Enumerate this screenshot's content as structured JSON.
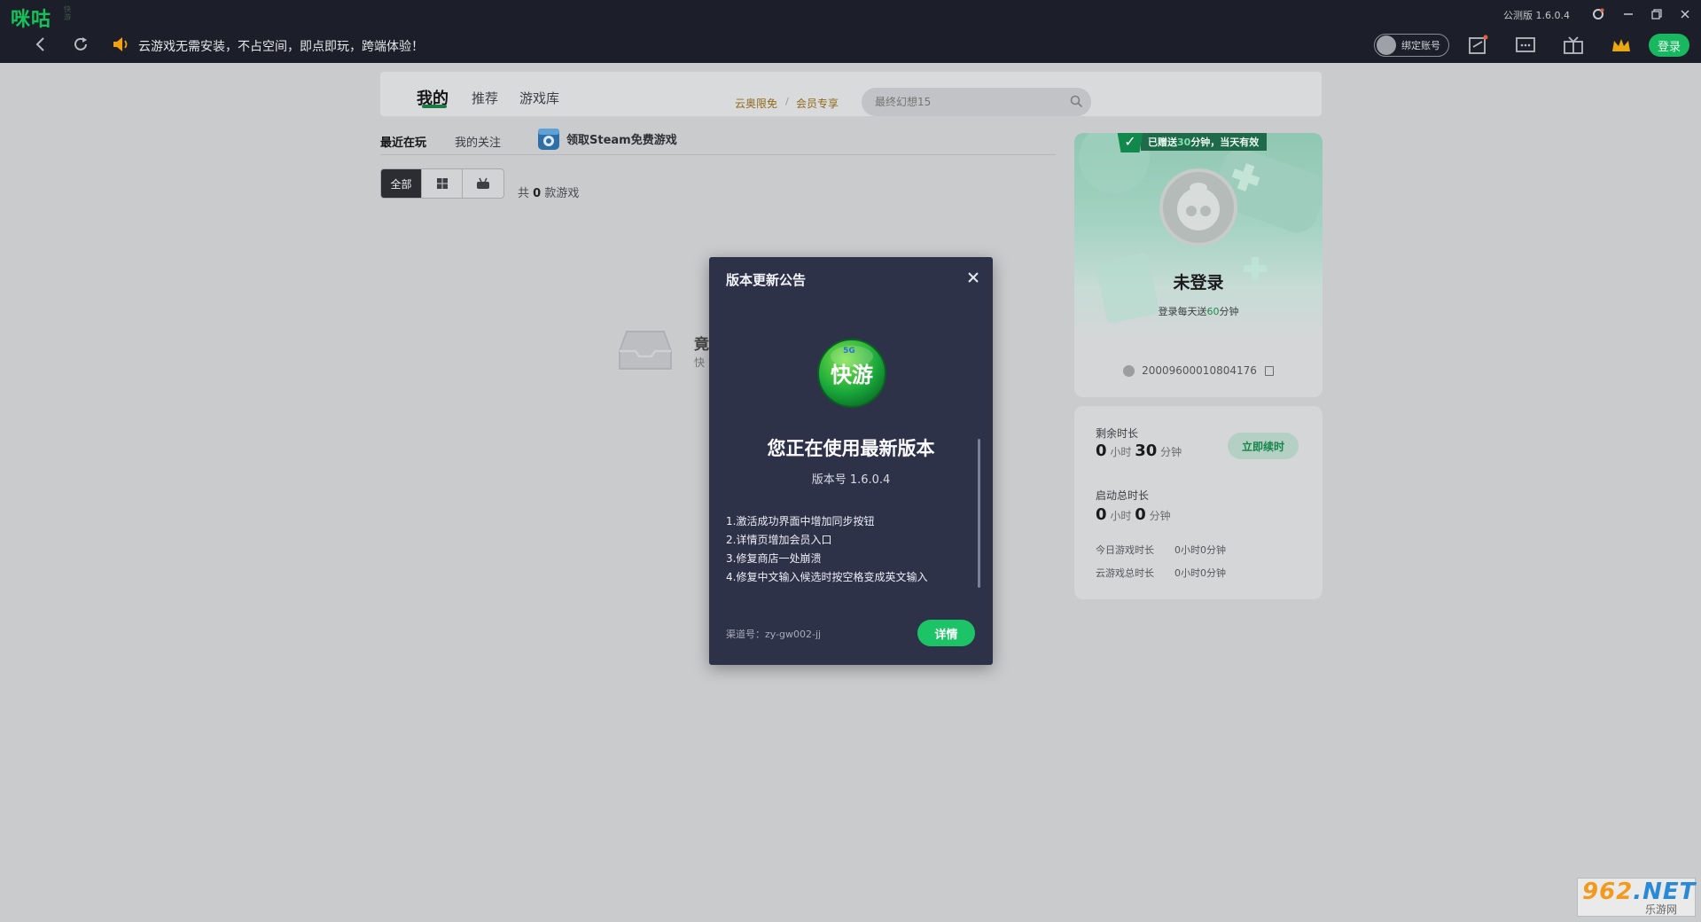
{
  "app": {
    "logo": "咪咕",
    "logo_sub": "快游",
    "version_label": "公测版 1.6.0.4"
  },
  "toolbar": {
    "notice": "云游戏无需安装，不占空间，即点即玩，跨端体验！",
    "steam_bind": "绑定账号",
    "login": "登录"
  },
  "nav": {
    "tabs": [
      "我的",
      "推荐",
      "游戏库"
    ],
    "promos": [
      "云奥限免",
      "会员专享"
    ],
    "promo_sep": "/",
    "search_placeholder": "最终幻想15"
  },
  "library": {
    "subtabs": [
      "最近在玩",
      "我的关注"
    ],
    "steam_free": "领取Steam免费游戏",
    "filters": [
      "全部",
      "windows",
      "console"
    ],
    "count_prefix": "共",
    "count": "0",
    "count_suffix": "款游戏",
    "empty_title": "竟",
    "empty_sub": "快"
  },
  "profile": {
    "gift_prefix": "已赠送",
    "gift_minutes": "30",
    "gift_suffix": "分钟，当天有效",
    "name": "未登录",
    "daily_prefix": "登录每天送",
    "daily_minutes": "60",
    "daily_suffix": "分钟",
    "uid": "2000960001080417​6"
  },
  "time": {
    "remaining_label": "剩余时长",
    "remaining_h": "0",
    "remaining_m": "30",
    "hour_unit": "小时",
    "min_unit": "分钟",
    "renew": "立即续时",
    "total_label": "启动总时长",
    "total_h": "0",
    "total_m": "0",
    "today_label": "今日游戏时长",
    "today_value": "0小时0分钟",
    "cloud_label": "云游戏总时长",
    "cloud_value": "0小时0分钟"
  },
  "modal": {
    "title": "版本更新公告",
    "logo_text": "快游",
    "logo_badge": "5G",
    "heading": "您正在使用最新版本",
    "version": "版本号 1.6.0.4",
    "notes": [
      "1.激活成功界面中增加同步按钮",
      "2.详情页增加会员入口",
      "3.修复商店一处崩溃",
      "4.修复中文输入候选时按空格变成英文输入"
    ],
    "channel": "渠道号：zy-gw002-jj",
    "detail": "详情"
  },
  "watermark": {
    "num": "962",
    "net": ".NET",
    "sub": "乐游网"
  },
  "colors": {
    "accent": "#1cc467",
    "titlebar": "#1c1f2a",
    "modal": "#2e3249"
  }
}
